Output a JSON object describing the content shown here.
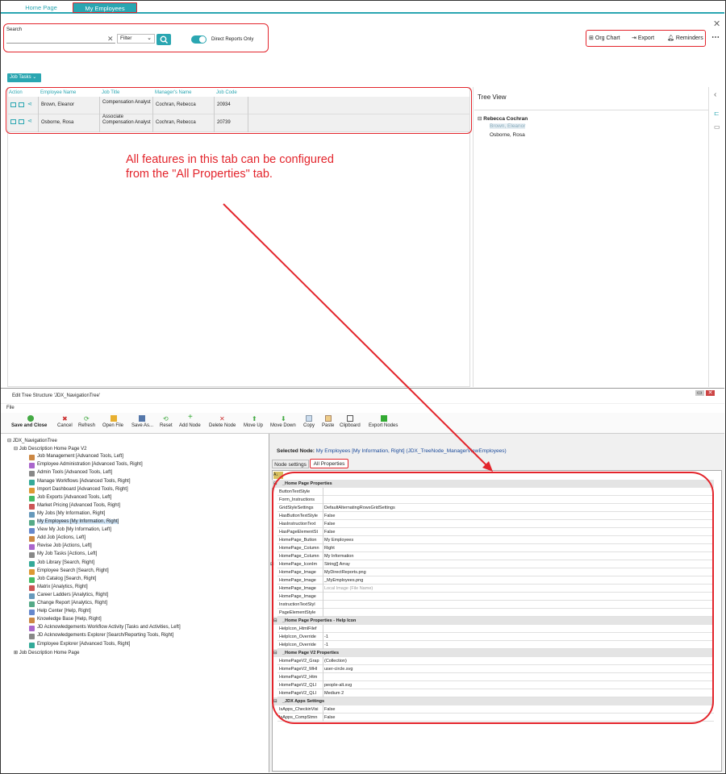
{
  "tabs": {
    "home": "Home Page",
    "employees": "My Employees"
  },
  "search": {
    "label": "Search",
    "placeholder": "",
    "filter": "Filter",
    "toggle_label": "Direct Reports Only"
  },
  "tools": {
    "org_chart": "Org Chart",
    "export": "Export",
    "reminders": "Reminders"
  },
  "job_tasks": "Job Tasks",
  "grid": {
    "headers": [
      "Action",
      "Employee Name",
      "Job Title",
      "Manager's Name",
      "Job Code"
    ],
    "rows": [
      {
        "name": "Brown, Eleanor",
        "title": "Compensation Analyst",
        "manager": "Cochran, Rebecca",
        "code": "20934"
      },
      {
        "name": "Osborne, Rosa",
        "title": "Associate Compensation Analyst",
        "manager": "Cochran, Rebecca",
        "code": "20739"
      }
    ]
  },
  "note": [
    "All features in this tab can be configured",
    "from the \"All Properties\" tab."
  ],
  "tree_view": {
    "title": "Tree View",
    "root": "Rebecca Cochran",
    "children": [
      "Brown, Eleanor",
      "Osborne, Rosa"
    ]
  },
  "editor": {
    "title": "Edit Tree Structure 'JDX_NavigationTree'",
    "menu": "File",
    "toolbar": [
      "Save and Close",
      "Cancel",
      "Refresh",
      "Open File",
      "Save As...",
      "Reset",
      "Add Node",
      "Delete Node",
      "Move Up",
      "Move Down",
      "Copy",
      "Paste",
      "Clipboard",
      "Export Nodes"
    ],
    "tree": [
      "JDX_NavigationTree",
      "Job Description Home Page V2",
      "Job Management [Advanced Tools, Left]",
      "Employee Administration [Advanced Tools, Right]",
      "Admin Tools [Advanced Tools, Left]",
      "Manage Workflows [Advanced Tools, Right]",
      "Import Dashboard [Advanced Tools, Right]",
      "Job Exports [Advanced Tools, Left]",
      "Market Pricing [Advanced Tools, Right]",
      "My Jobs [My Information, Right]",
      "My Employees [My Information, Right]",
      "View My Job [My Information, Left]",
      "Add Job [Actions, Left]",
      "Revise Job [Actions, Left]",
      "My Job Tasks [Actions, Left]",
      "Job Library [Search, Right]",
      "Employee Search [Search, Right]",
      "Job Catalog [Search, Right]",
      "Matrix [Analytics, Right]",
      "Career Ladders [Analytics, Right]",
      "Change Report [Analytics, Right]",
      "Help Center [Help, Right]",
      "Knowledge Base [Help, Right]",
      "JD Acknowledgements Workflow Activity [Tasks and Activities, Left]",
      "JD Acknowledgements Explorer [Search/Reporting Tools, Right]",
      "Employee Explorer [Advanced Tools, Right]",
      "Job Description Home Page"
    ],
    "selected_label": "Selected Node:",
    "selected_value": "My Employees [My Information, Right] (JDX_TreeNode_ManagerViewEmployees)",
    "prop_tabs": [
      "Node settings",
      "All Properties"
    ],
    "properties": [
      {
        "cat": "_Home Page Properties",
        "rows": [
          [
            "ButtonTextStyle",
            ""
          ],
          [
            "Form_Instructions",
            ""
          ],
          [
            "GridStyleSettings",
            "DefaultAlternatingRowsGridSettings"
          ],
          [
            "HasButtonTextStyle",
            "False"
          ],
          [
            "HasInstructionText",
            "False"
          ],
          [
            "HasPageElementSt",
            "False"
          ],
          [
            "HomePage_Button",
            "My Employees"
          ],
          [
            "HomePage_Column",
            "Right"
          ],
          [
            "HomePage_Column",
            "My Information"
          ],
          [
            "HomePage_IconIm",
            "String[] Array"
          ],
          [
            "HomePage_Image",
            "MyDirectReports.png"
          ],
          [
            "HomePage_Image",
            "_MyEmployees.png"
          ],
          [
            "HomePage_Image",
            "Local Image (File Name)"
          ],
          [
            "HomePage_Image",
            ""
          ],
          [
            "InstructionTextStyl",
            ""
          ],
          [
            "PageElementStyle",
            ""
          ]
        ]
      },
      {
        "cat": "_Home Page Properties - Help Icon",
        "rows": [
          [
            "HelpIcon_HtmlFilef",
            ""
          ],
          [
            "HelpIcon_Override",
            "-1"
          ],
          [
            "HelpIcon_Override",
            "-1"
          ]
        ]
      },
      {
        "cat": "_Home Page V2 Properties",
        "rows": [
          [
            "HomePageV2_Grap",
            "(Collection)"
          ],
          [
            "HomePageV2_MHI",
            "user-circle.svg"
          ],
          [
            "HomePageV2_Htm",
            ""
          ],
          [
            "HomePageV2_QLI",
            "people-alt.svg"
          ],
          [
            "HomePageV2_QLI",
            "Medium 2"
          ]
        ]
      },
      {
        "cat": "_JDX Apps Settings",
        "rows": [
          [
            "IsApps_CheckinVisi",
            "False"
          ],
          [
            "IsApps_CompStmn",
            "False"
          ]
        ]
      }
    ]
  }
}
